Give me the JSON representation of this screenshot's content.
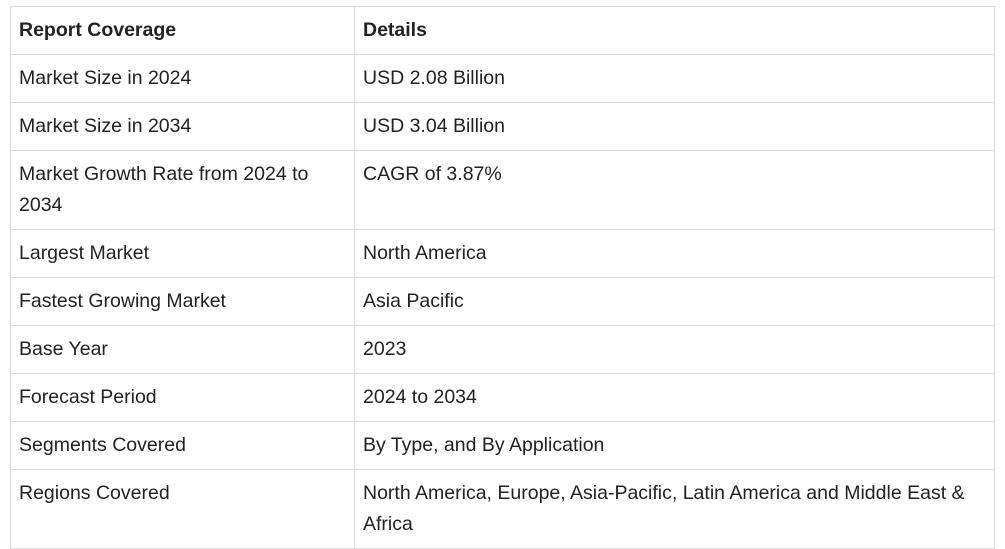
{
  "table": {
    "headers": [
      "Report Coverage",
      "Details"
    ],
    "rows": [
      {
        "label": "Market Size in 2024",
        "value": "USD 2.08 Billion"
      },
      {
        "label": "Market Size in 2034",
        "value": "USD 3.04 Billion"
      },
      {
        "label": "Market Growth Rate from 2024 to 2034",
        "value": "CAGR of 3.87%"
      },
      {
        "label": "Largest Market",
        "value": "North America"
      },
      {
        "label": "Fastest Growing Market",
        "value": "Asia Pacific"
      },
      {
        "label": "Base Year",
        "value": "2023"
      },
      {
        "label": "Forecast Period",
        "value": "2024 to 2034"
      },
      {
        "label": "Segments Covered",
        "value": "By Type, and By Application"
      },
      {
        "label": "Regions Covered",
        "value": "North America, Europe, Asia-Pacific, Latin America and Middle East & Africa"
      }
    ]
  },
  "colors": {
    "border": "#dcdcdc",
    "text": "#222222",
    "background": "#ffffff"
  }
}
